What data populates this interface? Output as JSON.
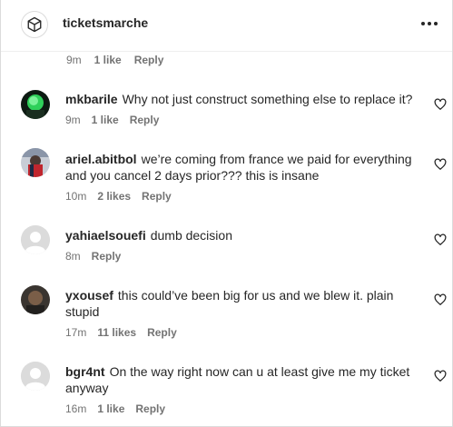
{
  "header": {
    "account_name": "ticketsmarche",
    "more_icon": "more-horizontal-icon"
  },
  "top_comment_meta": {
    "time": "9m",
    "likes": "1 like",
    "reply": "Reply"
  },
  "comments": [
    {
      "username": "mkbarile",
      "text": "Why not just construct something else to replace it?",
      "time": "9m",
      "likes": "1 like",
      "reply": "Reply",
      "avatar": "photo"
    },
    {
      "username": "ariel.abitbol",
      "text": "we’re coming from france we paid for everything and you cancel 2 days prior??? this is insane",
      "time": "10m",
      "likes": "2 likes",
      "reply": "Reply",
      "avatar": "photo"
    },
    {
      "username": "yahiaelsouefi",
      "text": "dumb decision",
      "time": "8m",
      "likes": "",
      "reply": "Reply",
      "avatar": "default"
    },
    {
      "username": "yxousef",
      "text": "this could’ve been big for us and we blew it. plain stupid",
      "time": "17m",
      "likes": "11 likes",
      "reply": "Reply",
      "avatar": "photo"
    },
    {
      "username": "bgr4nt",
      "text": "On the way right now can u at least give me my ticket anyway",
      "time": "16m",
      "likes": "1 like",
      "reply": "Reply",
      "avatar": "default"
    }
  ],
  "colors": {
    "text": "#262626",
    "secondary": "#737373",
    "divider": "#efefef",
    "default_avatar": "#dbdbdb"
  }
}
